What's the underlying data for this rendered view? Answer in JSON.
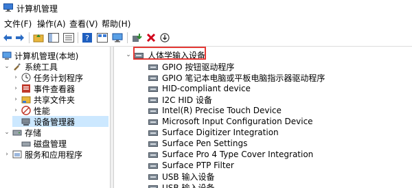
{
  "window": {
    "title": "计算机管理"
  },
  "menu": [
    {
      "label": "文件(F)"
    },
    {
      "label": "操作(A)"
    },
    {
      "label": "查看(V)"
    },
    {
      "label": "帮助(H)"
    }
  ],
  "left_tree": [
    {
      "label": "计算机管理(本地)"
    },
    {
      "label": "系统工具"
    },
    {
      "label": "任务计划程序"
    },
    {
      "label": "事件查看器"
    },
    {
      "label": "共享文件夹"
    },
    {
      "label": "性能"
    },
    {
      "label": "设备管理器"
    },
    {
      "label": "存储"
    },
    {
      "label": "磁盘管理"
    },
    {
      "label": "服务和应用程序"
    }
  ],
  "device_category": "人体学输入设备",
  "devices": [
    "GPIO 按钮驱动程序",
    "GPIO 笔记本电脑或平板电脑指示器驱动程序",
    "HID-compliant device",
    "I2C HID 设备",
    "Intel(R) Precise Touch Device",
    "Microsoft Input Configuration Device",
    "Surface Digitizer Integration",
    "Surface Pen Settings",
    "Surface Pro 4 Type Cover Integration",
    "Surface PTP Filter",
    "USB 输入设备",
    "USB 输入设备"
  ],
  "colors": {
    "selection": "#cce8ff",
    "highlight_border": "#e53935",
    "delete_icon": "#d0021b",
    "help_icon": "#1f5fbf"
  }
}
